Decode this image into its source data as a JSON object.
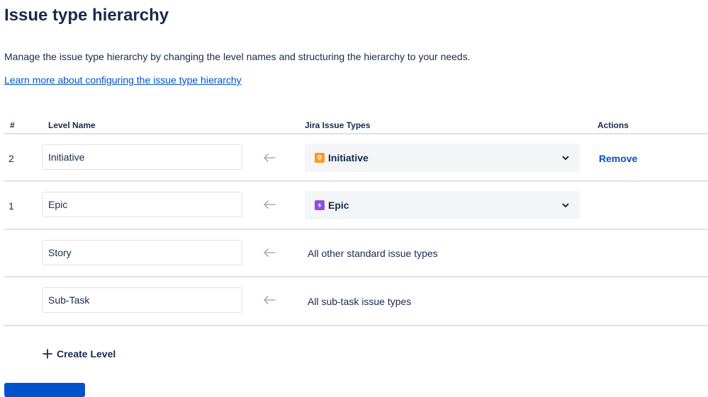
{
  "page": {
    "title": "Issue type hierarchy",
    "description": "Manage the issue type hierarchy by changing the level names and structuring the hierarchy to your needs.",
    "learn_more": "Learn more about configuring the issue type hierarchy"
  },
  "table": {
    "headers": {
      "num": "#",
      "level_name": "Level Name",
      "jira_types": "Jira Issue Types",
      "actions": "Actions"
    },
    "rows": [
      {
        "num": "2",
        "level_name": "Initiative",
        "issue_type": "Initiative",
        "issue_icon": "initiative-icon",
        "icon_color": "#ff991f",
        "action": "Remove"
      },
      {
        "num": "1",
        "level_name": "Epic",
        "issue_type": "Epic",
        "issue_icon": "epic-icon",
        "icon_color": "#904ee2"
      },
      {
        "num": "",
        "level_name": "Story",
        "issue_type_text": "All other standard issue types"
      },
      {
        "num": "",
        "level_name": "Sub-Task",
        "issue_type_text": "All sub-task issue types"
      }
    ]
  },
  "create_level": "Create Level",
  "colors": {
    "link": "#0052cc",
    "text": "#172b4d",
    "divider": "#dfe1e6",
    "select_bg": "#f4f5f7",
    "arrow": "#a5adba"
  }
}
